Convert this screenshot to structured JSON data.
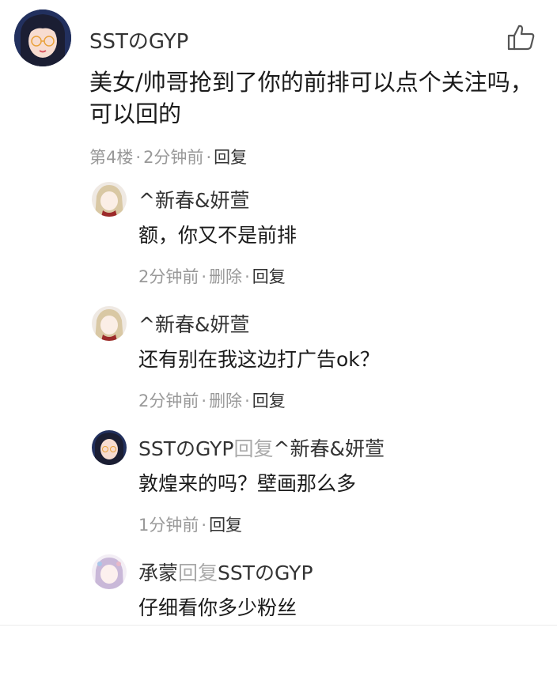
{
  "main": {
    "username": "SSTのGYP",
    "text": "美女/帅哥抢到了你的前排可以点个关注吗，可以回的",
    "floor": "第4楼",
    "time": "2分钟前",
    "reply_label": "回复",
    "like_icon": "thumbs-up-icon"
  },
  "replies": [
    {
      "name": "^新春&妍萱",
      "reply_word": "",
      "target": "",
      "text": "额，你又不是前排",
      "time": "2分钟前",
      "delete_label": "删除",
      "reply_label": "回复"
    },
    {
      "name": "^新春&妍萱",
      "reply_word": "",
      "target": "",
      "text": "还有别在我这边打广告ok？",
      "time": "2分钟前",
      "delete_label": "删除",
      "reply_label": "回复"
    },
    {
      "name": "SSTのGYP",
      "reply_word": "回复",
      "target": "^新春&妍萱",
      "text": "敦煌来的吗？壁画那么多",
      "time": "1分钟前",
      "reply_label": "回复"
    },
    {
      "name": "承蒙",
      "reply_word": "回复",
      "target": "SSTのGYP",
      "text": "仔细看你多少粉丝"
    }
  ],
  "colors": {
    "meta": "#999999",
    "text": "#1a1a1a",
    "reply_word": "#aaaaaa"
  }
}
